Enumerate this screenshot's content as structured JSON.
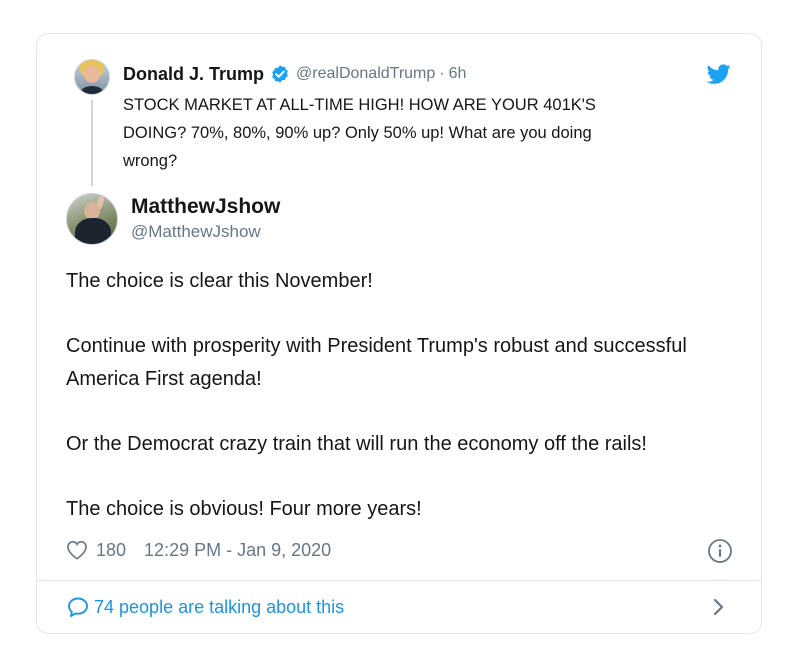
{
  "parent_tweet": {
    "name": "Donald J. Trump",
    "handle": "@realDonaldTrump",
    "separator": "·",
    "time": "6h",
    "text": "STOCK MARKET AT ALL-TIME HIGH! HOW ARE YOUR 401K'S\nDOING? 70%, 80%, 90% up? Only 50% up! What are you doing\nwrong?",
    "icons": {
      "avatar": "profile-photo",
      "verified": "verified-badge-icon",
      "logo": "twitter-bird-icon"
    }
  },
  "tweet": {
    "name": "MatthewJshow",
    "handle": "@MatthewJshow",
    "paragraphs": [
      "The choice is clear this November!",
      "Continue with prosperity with President Trump's robust and successful America First agenda!",
      "Or the Democrat crazy train that will run the economy off the rails!",
      "The choice is obvious! Four more years!"
    ],
    "likes": "180",
    "timestamp": "12:29 PM - Jan 9, 2020",
    "icons": {
      "like": "heart-icon",
      "info": "info-icon"
    }
  },
  "footer": {
    "talking": "74 people are talking about this",
    "icons": {
      "reply": "speech-bubble-icon",
      "more": "chevron-right-icon"
    }
  },
  "colors": {
    "accent": "#1b95e0",
    "text": "#14171a",
    "secondary_text": "#657786",
    "border": "#e1e8ed"
  }
}
